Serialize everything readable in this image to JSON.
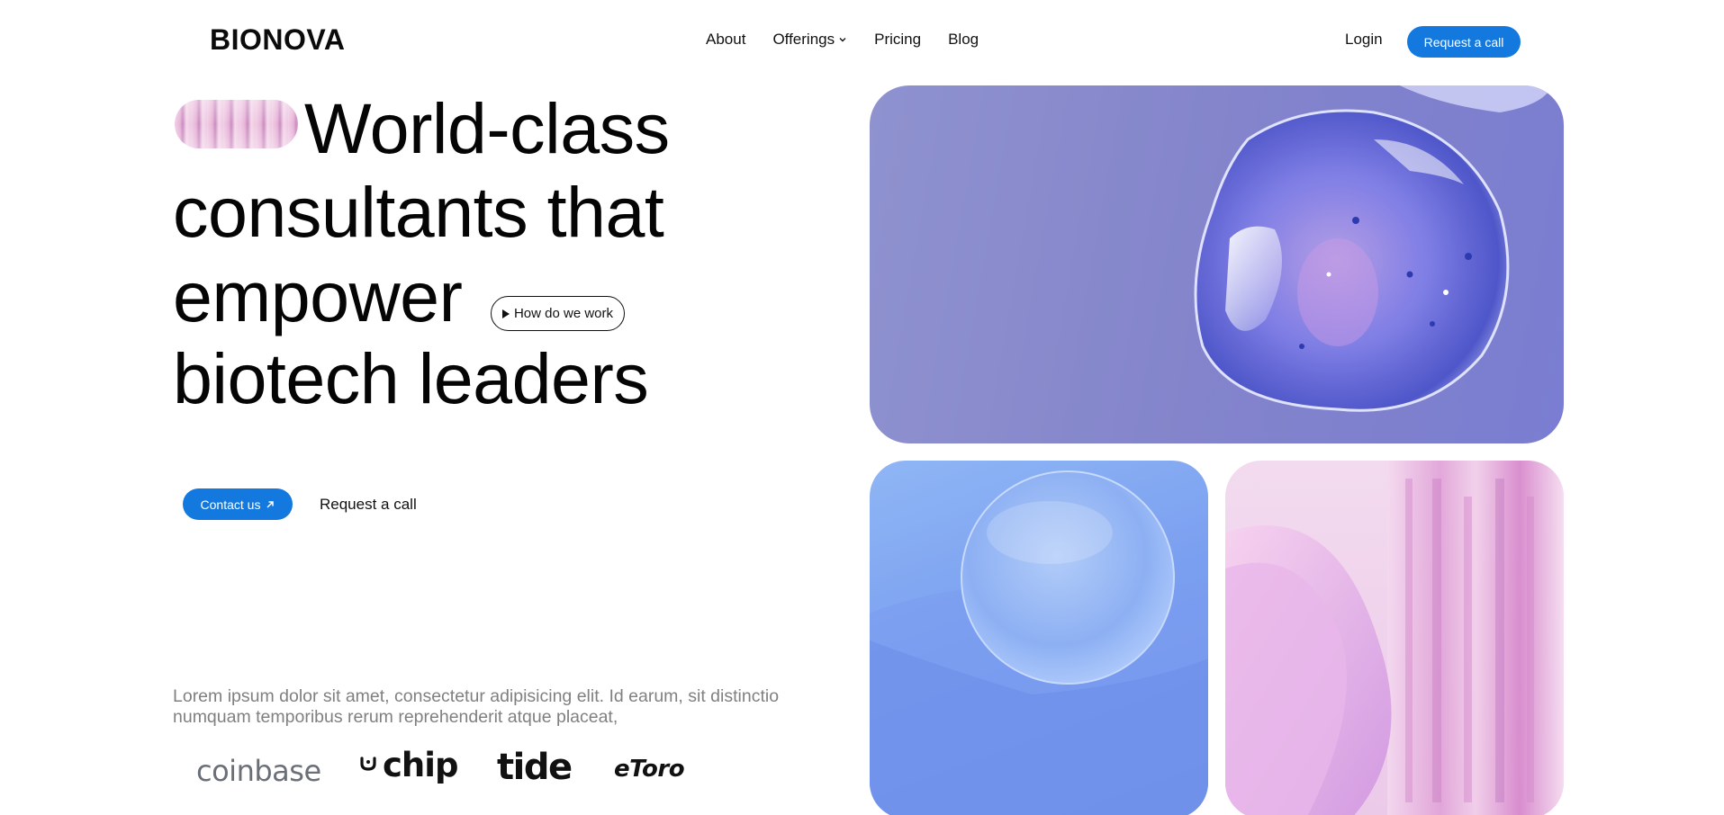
{
  "brand": {
    "logo": "BIONOVA"
  },
  "nav": {
    "links": [
      "About",
      "Offerings",
      "Pricing",
      "Blog"
    ],
    "login": "Login",
    "cta": "Request a call"
  },
  "hero": {
    "line1": "World-class",
    "line2": "consultants that",
    "line3": "empower",
    "line4": "biotech leaders",
    "how_button": "How do we work",
    "contact_button": "Contact us",
    "request_link": "Request a call",
    "description": "Lorem ipsum dolor sit amet, consectetur adipisicing elit. Id earum, sit distinctio numquam temporibus rerum reprehenderit atque placeat,"
  },
  "partners": [
    "coinbase",
    "chip",
    "tide",
    "eToro"
  ],
  "colors": {
    "accent": "#1479de",
    "text": "#0a0a0a",
    "muted": "#808080"
  }
}
